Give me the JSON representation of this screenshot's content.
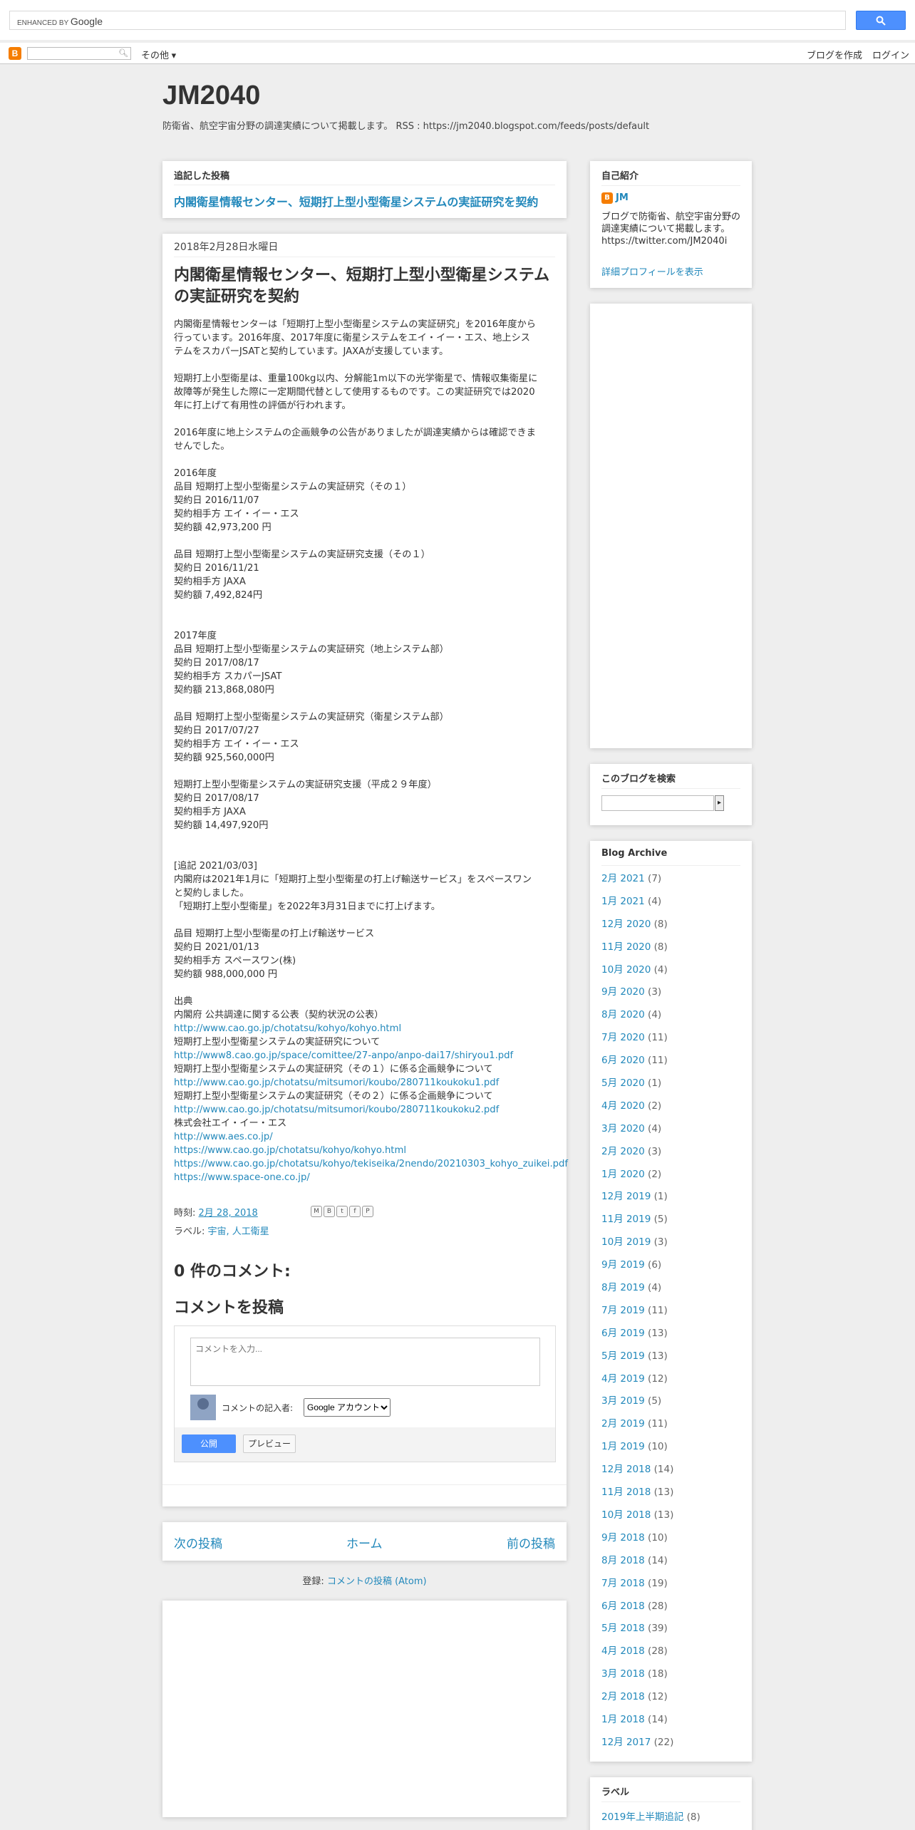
{
  "gsearch": {
    "enhanced_by": "ENHANCED BY",
    "google": "Google",
    "button_icon": "search-icon"
  },
  "navbar": {
    "logo": "B",
    "more": "その他 ▾",
    "create_blog": "ブログを作成",
    "login": "ログイン"
  },
  "header": {
    "title": "JM2040",
    "description": "防衛省、航空宇宙分野の調達実績について掲載します。 RSS : https://jm2040.blogspot.com/feeds/posts/default"
  },
  "featured": {
    "heading": "追記した投稿",
    "title": "内閣衛星情報センター、短期打上型小型衛星システムの実証研究を契約"
  },
  "post": {
    "date": "2018年2月28日水曜日",
    "title": "内閣衛星情報センター、短期打上型小型衛星システムの実証研究を契約",
    "body_lines": [
      {
        "t": "内閣衛星情報センターは「短期打上型小型衛星システムの実証研究」を2016年度から"
      },
      {
        "t": "行っています。2016年度、2017年度に衛星システムをエイ・イー・エス、地上シス"
      },
      {
        "t": "テムをスカパーJSATと契約しています。JAXAが支援しています。"
      },
      {
        "t": ""
      },
      {
        "t": "短期打上小型衛星は、重量100kg以内、分解能1m以下の光学衛星で、情報収集衛星に"
      },
      {
        "t": "故障等が発生した際に一定期間代替として使用するものです。この実証研究では2020"
      },
      {
        "t": "年に打上げて有用性の評価が行われます。"
      },
      {
        "t": ""
      },
      {
        "t": "2016年度に地上システムの企画競争の公告がありましたが調達実績からは確認できま"
      },
      {
        "t": "せんでした。"
      },
      {
        "t": ""
      },
      {
        "t": "2016年度"
      },
      {
        "t": "品目 短期打上型小型衛星システムの実証研究（その１）"
      },
      {
        "t": "契約日 2016/11/07"
      },
      {
        "t": "契約相手方 エイ・イー・エス"
      },
      {
        "t": "契約額 42,973,200 円"
      },
      {
        "t": ""
      },
      {
        "t": "品目 短期打上型小型衛星システムの実証研究支援（その１）"
      },
      {
        "t": "契約日 2016/11/21"
      },
      {
        "t": "契約相手方 JAXA"
      },
      {
        "t": "契約額 7,492,824円"
      },
      {
        "t": ""
      },
      {
        "t": ""
      },
      {
        "t": "2017年度"
      },
      {
        "t": "品目 短期打上型小型衛星システムの実証研究（地上システム部）"
      },
      {
        "t": "契約日 2017/08/17"
      },
      {
        "t": "契約相手方 スカパーJSAT"
      },
      {
        "t": "契約額 213,868,080円"
      },
      {
        "t": ""
      },
      {
        "t": "品目 短期打上型小型衛星システムの実証研究（衛星システム部）"
      },
      {
        "t": "契約日 2017/07/27"
      },
      {
        "t": "契約相手方 エイ・イー・エス"
      },
      {
        "t": "契約額 925,560,000円"
      },
      {
        "t": ""
      },
      {
        "t": "短期打上型小型衛星システムの実証研究支援（平成２９年度）"
      },
      {
        "t": "契約日 2017/08/17"
      },
      {
        "t": "契約相手方 JAXA"
      },
      {
        "t": "契約額 14,497,920円"
      },
      {
        "t": ""
      },
      {
        "t": ""
      },
      {
        "t": "[追記 2021/03/03]"
      },
      {
        "t": "内閣府は2021年1月に「短期打上型小型衛星の打上げ輸送サービス」をスペースワン"
      },
      {
        "t": "と契約しました。"
      },
      {
        "t": "「短期打上型小型衛星」を2022年3月31日までに打上げます。"
      },
      {
        "t": ""
      },
      {
        "t": "品目 短期打上型小型衛星の打上げ輸送サービス"
      },
      {
        "t": "契約日 2021/01/13"
      },
      {
        "t": "契約相手方 スペースワン(株)"
      },
      {
        "t": "契約額 988,000,000 円"
      },
      {
        "t": ""
      },
      {
        "t": "出典"
      },
      {
        "t": "内閣府 公共調達に関する公表（契約状況の公表）"
      },
      {
        "t": "http://www.cao.go.jp/chotatsu/kohyo/kohyo.html",
        "link": true
      },
      {
        "t": "短期打上型小型衛星システムの実証研究について"
      },
      {
        "t": "http://www8.cao.go.jp/space/comittee/27-anpo/anpo-dai17/shiryou1.pdf",
        "link": true
      },
      {
        "t": "短期打上型小型衛星システムの実証研究（その１）に係る企画競争について"
      },
      {
        "t": "http://www.cao.go.jp/chotatsu/mitsumori/koubo/280711koukoku1.pdf",
        "link": true
      },
      {
        "t": "短期打上型小型衛星システムの実証研究（その２）に係る企画競争について"
      },
      {
        "t": "http://www.cao.go.jp/chotatsu/mitsumori/koubo/280711koukoku2.pdf",
        "link": true
      },
      {
        "t": "株式会社エイ・イー・エス"
      },
      {
        "t": "http://www.aes.co.jp/",
        "link": true
      },
      {
        "t": "https://www.cao.go.jp/chotatsu/kohyo/kohyo.html",
        "link": true
      },
      {
        "t": "https://www.cao.go.jp/chotatsu/kohyo/tekiseika/2nendo/20210303_kohyo_zuikei.pdf",
        "link": true
      },
      {
        "t": "https://www.space-one.co.jp/",
        "link": true
      }
    ],
    "time_label": "時刻:",
    "time_value": "2月 28, 2018",
    "labels_label": "ラベル:",
    "labels_value": "宇宙, 人工衛星",
    "comment_count": "0 件のコメント:",
    "comment_post": "コメントを投稿",
    "comment_placeholder": "コメントを入力...",
    "comment_as": "コメントの記入者:",
    "comment_account": "Google アカウント",
    "publish": "公開",
    "preview": "プレビュー"
  },
  "pager": {
    "newer": "次の投稿",
    "home": "ホーム",
    "older": "前の投稿"
  },
  "subscribe": {
    "label": "登録:",
    "link": "コメントの投稿 (Atom)"
  },
  "profile": {
    "heading": "自己紹介",
    "name": "JM",
    "description": "ブログで防衛省、航空宇宙分野の調達実績について掲載します。https://twitter.com/JM2040i",
    "more": "詳細プロフィールを表示"
  },
  "blog_search": {
    "heading": "このブログを検索"
  },
  "archive": {
    "heading": "Blog Archive",
    "items": [
      {
        "m": "2月 2021",
        "c": "(7)"
      },
      {
        "m": "1月 2021",
        "c": "(4)"
      },
      {
        "m": "12月 2020",
        "c": "(8)"
      },
      {
        "m": "11月 2020",
        "c": "(8)"
      },
      {
        "m": "10月 2020",
        "c": "(4)"
      },
      {
        "m": "9月 2020",
        "c": "(3)"
      },
      {
        "m": "8月 2020",
        "c": "(4)"
      },
      {
        "m": "7月 2020",
        "c": "(11)"
      },
      {
        "m": "6月 2020",
        "c": "(11)"
      },
      {
        "m": "5月 2020",
        "c": "(1)"
      },
      {
        "m": "4月 2020",
        "c": "(2)"
      },
      {
        "m": "3月 2020",
        "c": "(4)"
      },
      {
        "m": "2月 2020",
        "c": "(3)"
      },
      {
        "m": "1月 2020",
        "c": "(2)"
      },
      {
        "m": "12月 2019",
        "c": "(1)"
      },
      {
        "m": "11月 2019",
        "c": "(5)"
      },
      {
        "m": "10月 2019",
        "c": "(3)"
      },
      {
        "m": "9月 2019",
        "c": "(6)"
      },
      {
        "m": "8月 2019",
        "c": "(4)"
      },
      {
        "m": "7月 2019",
        "c": "(11)"
      },
      {
        "m": "6月 2019",
        "c": "(13)"
      },
      {
        "m": "5月 2019",
        "c": "(13)"
      },
      {
        "m": "4月 2019",
        "c": "(12)"
      },
      {
        "m": "3月 2019",
        "c": "(5)"
      },
      {
        "m": "2月 2019",
        "c": "(11)"
      },
      {
        "m": "1月 2019",
        "c": "(10)"
      },
      {
        "m": "12月 2018",
        "c": "(14)"
      },
      {
        "m": "11月 2018",
        "c": "(13)"
      },
      {
        "m": "10月 2018",
        "c": "(13)"
      },
      {
        "m": "9月 2018",
        "c": "(10)"
      },
      {
        "m": "8月 2018",
        "c": "(14)"
      },
      {
        "m": "7月 2018",
        "c": "(19)"
      },
      {
        "m": "6月 2018",
        "c": "(28)"
      },
      {
        "m": "5月 2018",
        "c": "(39)"
      },
      {
        "m": "4月 2018",
        "c": "(28)"
      },
      {
        "m": "3月 2018",
        "c": "(18)"
      },
      {
        "m": "2月 2018",
        "c": "(12)"
      },
      {
        "m": "1月 2018",
        "c": "(14)"
      },
      {
        "m": "12月 2017",
        "c": "(22)"
      }
    ]
  },
  "labels_widget": {
    "heading": "ラベル",
    "item": "2019年上半期追記",
    "count": "(8)"
  },
  "colors": {
    "link": "#2288bb",
    "button_blue": "#4d90fe",
    "blogger_orange": "#f57d00",
    "page_bg": "#eeeeee"
  }
}
